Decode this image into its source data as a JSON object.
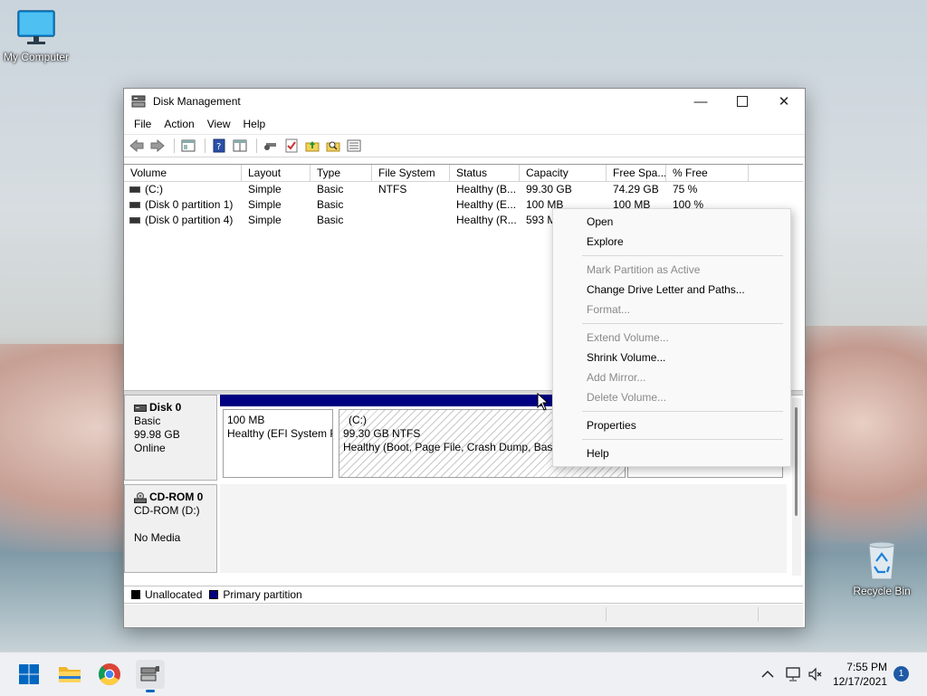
{
  "desktop": {
    "my_computer": "My Computer",
    "recycle_bin": "Recycle Bin"
  },
  "window": {
    "title": "Disk Management",
    "menu": [
      "File",
      "Action",
      "View",
      "Help"
    ]
  },
  "volume_list": {
    "columns": [
      "Volume",
      "Layout",
      "Type",
      "File System",
      "Status",
      "Capacity",
      "Free Spa...",
      "% Free"
    ],
    "rows": [
      [
        "(C:)",
        "Simple",
        "Basic",
        "NTFS",
        "Healthy (B...",
        "99.30 GB",
        "74.29 GB",
        "75 %"
      ],
      [
        "(Disk 0 partition 1)",
        "Simple",
        "Basic",
        "",
        "Healthy (E...",
        "100 MB",
        "100 MB",
        "100 %"
      ],
      [
        "(Disk 0 partition 4)",
        "Simple",
        "Basic",
        "",
        "Healthy (R...",
        "593 M",
        "",
        ""
      ]
    ]
  },
  "disk0": {
    "name": "Disk 0",
    "type": "Basic",
    "size": "99.98 GB",
    "state": "Online",
    "part1": {
      "size": "100 MB",
      "status": "Healthy (EFI System P"
    },
    "part2": {
      "letter": "(C:)",
      "size": "99.30 GB NTFS",
      "status": "Healthy (Boot, Page File, Crash Dump, Basic"
    }
  },
  "cdrom0": {
    "name": "CD-ROM 0",
    "type": "CD-ROM (D:)",
    "state": "No Media"
  },
  "legend": {
    "unallocated": "Unallocated",
    "primary": "Primary partition"
  },
  "context_menu": {
    "open": "Open",
    "explore": "Explore",
    "mark_active": "Mark Partition as Active",
    "change_letter": "Change Drive Letter and Paths...",
    "format": "Format...",
    "extend": "Extend Volume...",
    "shrink": "Shrink Volume...",
    "add_mirror": "Add Mirror...",
    "delete": "Delete Volume...",
    "properties": "Properties",
    "help": "Help"
  },
  "taskbar": {
    "time": "7:55 PM",
    "date": "12/17/2021",
    "notifications": "1"
  },
  "colors": {
    "primary_partition": "#000080",
    "unallocated": "#000000",
    "windows_blue": "#0067c0"
  }
}
